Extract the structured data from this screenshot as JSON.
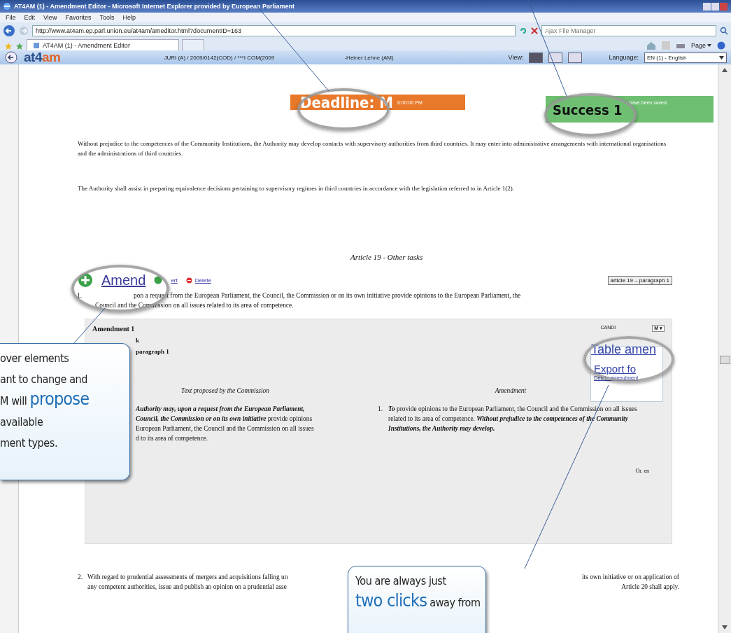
{
  "window": {
    "title": "AT4AM (1) - Amendment Editor - Microsoft Internet Explorer provided by European Parliament"
  },
  "menu": [
    "File",
    "Edit",
    "View",
    "Favorites",
    "Tools",
    "Help"
  ],
  "address": {
    "url": "http://www.at4am.ep.parl.union.eu/at4am/ameditor.html?documentID=163"
  },
  "search": {
    "placeholder": "Ajax File Manager"
  },
  "tab": {
    "label": "AT4AM (1) - Amendment Editor"
  },
  "command_bar": {
    "page_menu": "Page"
  },
  "app_header": {
    "logo": "at4am",
    "document": "JURI (A) / 2009/0142(COD) / ***I COM(2009",
    "rapporteur": "-Heiner Lehne (AM)",
    "view_label": "View:",
    "language_label": "Language:",
    "language": "EN (1) - English"
  },
  "deadline": {
    "label": "Deadline: M",
    "time": "6:00:00 PM"
  },
  "notification": {
    "title": "Success 1",
    "message": "have been saved"
  },
  "document": {
    "paragraphs": [
      "Without prejudice to the competences of the Community Institutions, the Authority may develop contacts with supervisory authorities from third countries. It may enter into administrative arrangements with international organisations and the administrations of third countries.",
      "The Authority shall assist in preparing equivalence decisions pertaining to supervisory regimes in third countries in accordance with the legislation referred to in Article 1(2)."
    ],
    "article_heading": "Article 19 - Other tasks",
    "actions": [
      {
        "kind": "amend",
        "label": "Amend"
      },
      {
        "kind": "insert",
        "label": "ert"
      },
      {
        "kind": "delete",
        "label": "Delete"
      }
    ],
    "reference": "article 19 – paragraph 1",
    "paragraph_1": {
      "number": "1.",
      "lines": [
        "pon a request from the European Parliament, the Council, the Commission or on its own initiative provide opinions to the European Parliament, the",
        "Council and the Commission on all issues related to its area of competence."
      ]
    },
    "amendment": {
      "title": "Amendment 1",
      "subtitle": "k",
      "reference": "paragraph 1",
      "status": "CANDI",
      "status_menu": "M ▾",
      "menu": [
        {
          "kind": "large",
          "label": "Table amen"
        },
        {
          "kind": "medium",
          "label": "Export fo"
        },
        {
          "kind": "small",
          "label": "Delete amendment"
        }
      ],
      "columns": [
        "Text proposed by the Commission",
        "Amendment"
      ],
      "original": [
        "**Authority may, upon a request from the European Parliament,**",
        "**Council, the Commission or on its own initiative** provide opinions",
        "European Parliament, the Council and the Commission on all issues",
        "d to its area of competence."
      ],
      "amended_number": "1.",
      "amended": "**To** provide opinions to the European Parliament, the Council and the Commission on all issues related to its area of competence. **Without prejudice to the competences of the Community Institutions, the Authority may develop.**",
      "language": "Or. en"
    },
    "paragraph_2": {
      "number": "2.",
      "left": [
        "With regard to prudential assessments of mergers and acquisitions falling un",
        "any competent authorities, issue and publish an opinion on a prudential asse"
      ],
      "right": [
        "its own initiative or on application of",
        "Article 20 shall apply."
      ]
    }
  },
  "callouts": [
    {
      "kind": "left",
      "lines": [
        [
          {
            "text": "over elements",
            "emphasis": false
          }
        ],
        [
          {
            "text": "ant to change and",
            "emphasis": false
          }
        ],
        [
          {
            "text": "M will ",
            "emphasis": false
          },
          {
            "text": "propose",
            "emphasis": true
          }
        ],
        [
          {
            "text": "available",
            "emphasis": false
          }
        ],
        [
          {
            "text": "ment types.",
            "emphasis": false
          }
        ]
      ]
    },
    {
      "kind": "bottom",
      "lines": [
        [
          {
            "text": "You are always just",
            "emphasis": false
          }
        ],
        [
          {
            "text": "two clicks",
            "emphasis": true
          },
          {
            "text": " away from",
            "emphasis": false
          }
        ]
      ]
    }
  ]
}
